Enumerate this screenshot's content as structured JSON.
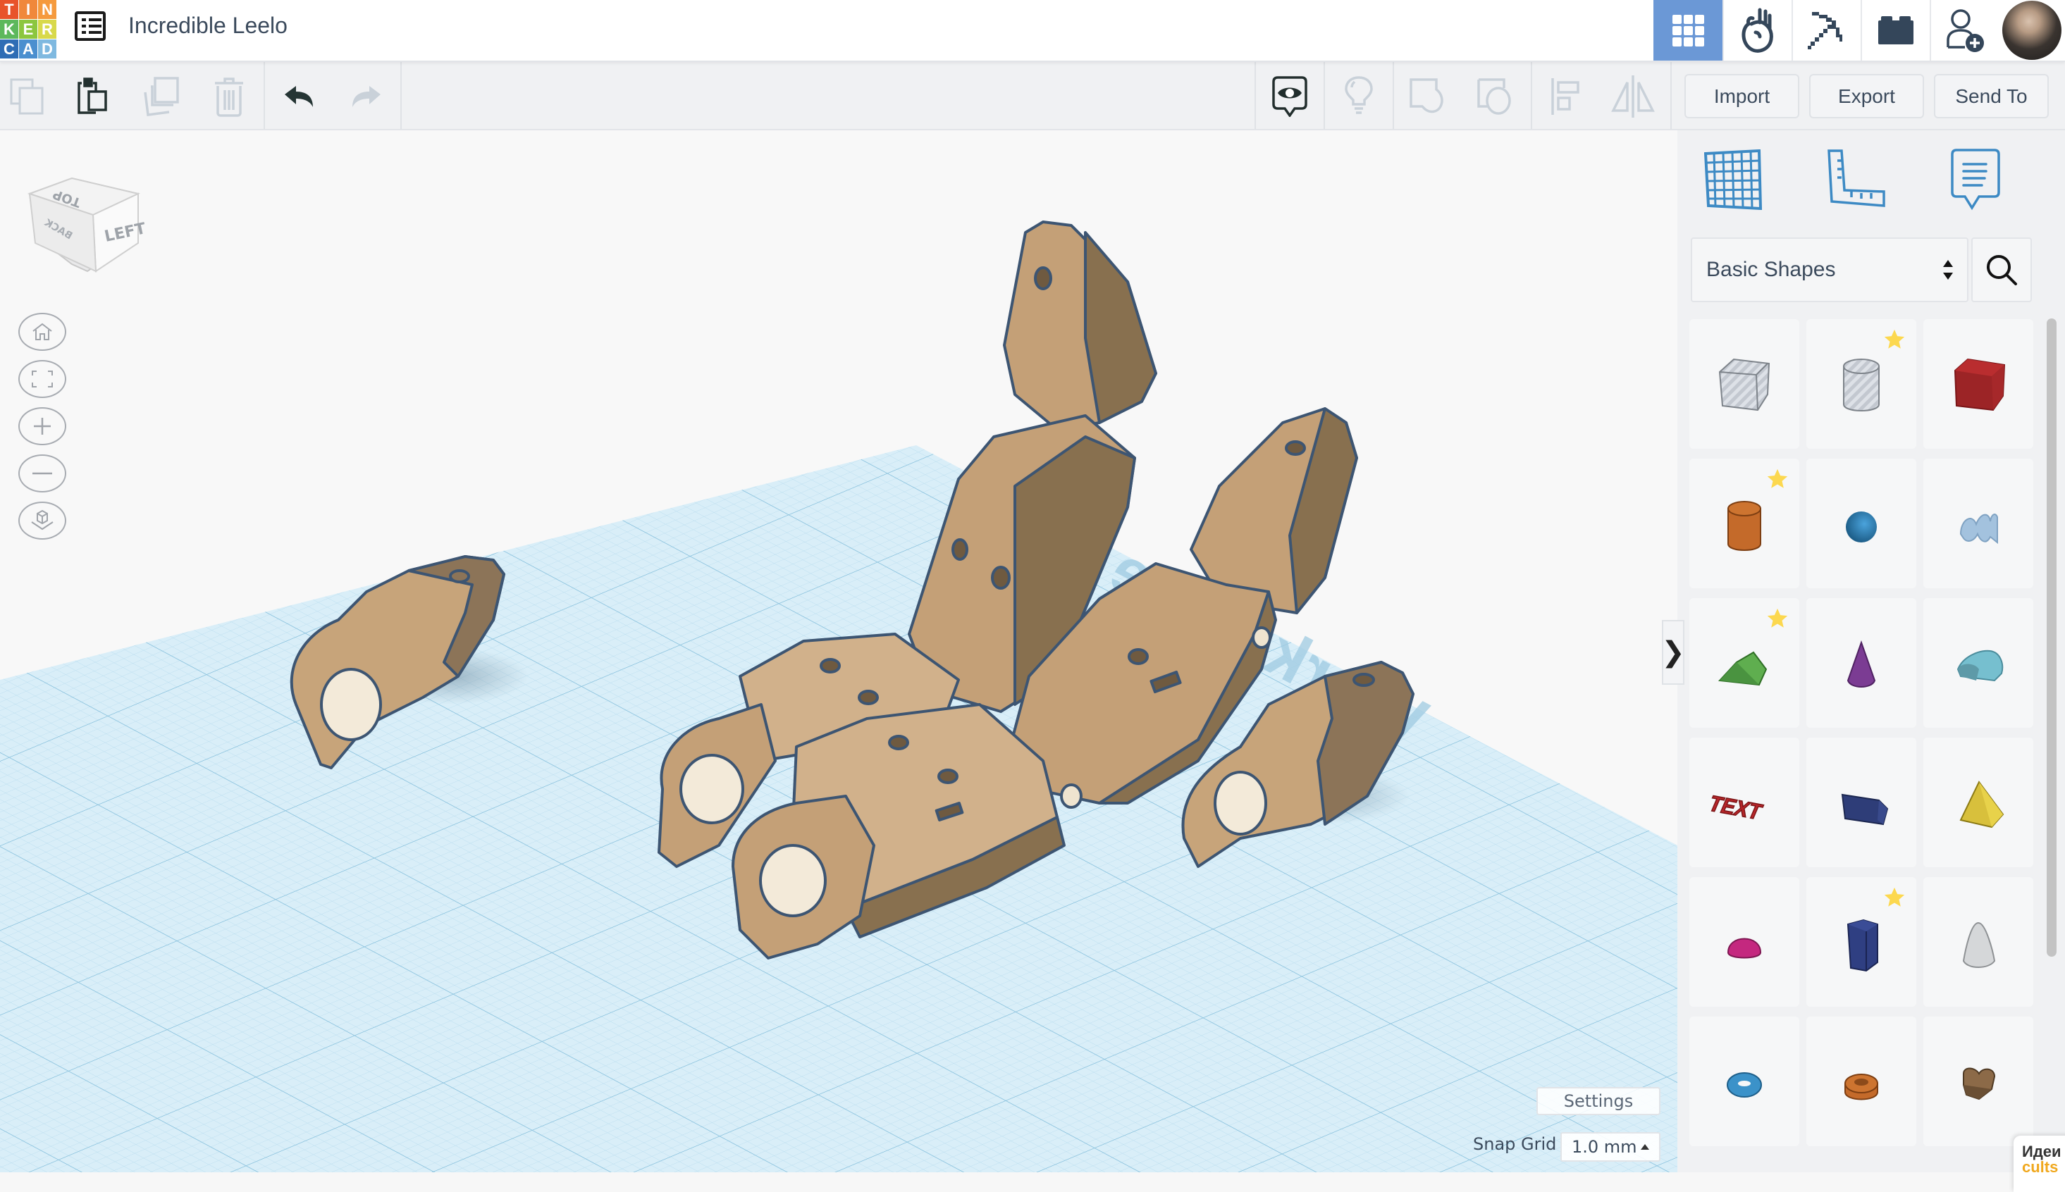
{
  "app": {
    "logo_letters": [
      "T",
      "I",
      "N",
      "K",
      "E",
      "R",
      "C",
      "A",
      "D"
    ],
    "logo_colors": [
      "#e8532b",
      "#f0883b",
      "#f59a3d",
      "#5db85c",
      "#8cc63f",
      "#d8d94b",
      "#2f6db5",
      "#4b8fcf",
      "#7fb9e0"
    ],
    "title": "Incredible Leelo"
  },
  "top_nav": {
    "items": [
      {
        "name": "3d-design",
        "icon": "grid-icon",
        "active": true
      },
      {
        "name": "lessons",
        "icon": "apple-hand-icon",
        "active": false
      },
      {
        "name": "minecraft",
        "icon": "pickaxe-icon",
        "active": false
      },
      {
        "name": "bricks",
        "icon": "brick-icon",
        "active": false
      },
      {
        "name": "invite",
        "icon": "add-user-icon",
        "active": false
      }
    ],
    "avatar": "user-avatar"
  },
  "toolbar": {
    "edit_tools": [
      {
        "name": "copy",
        "icon": "copy-icon",
        "enabled": false
      },
      {
        "name": "paste",
        "icon": "paste-icon",
        "enabled": true
      },
      {
        "name": "duplicate",
        "icon": "duplicate-icon",
        "enabled": false
      },
      {
        "name": "delete",
        "icon": "trash-icon",
        "enabled": false
      },
      {
        "name": "undo",
        "icon": "undo-icon",
        "enabled": true
      },
      {
        "name": "redo",
        "icon": "redo-icon",
        "enabled": false
      }
    ],
    "view_tools": [
      {
        "name": "show-all",
        "icon": "eye-bubble-icon",
        "enabled": true
      },
      {
        "name": "notes",
        "icon": "lightbulb-icon",
        "enabled": false
      },
      {
        "name": "group",
        "icon": "group-icon",
        "enabled": false
      },
      {
        "name": "ungroup",
        "icon": "ungroup-icon",
        "enabled": false
      },
      {
        "name": "align",
        "icon": "align-icon",
        "enabled": false
      },
      {
        "name": "mirror",
        "icon": "mirror-icon",
        "enabled": false
      }
    ],
    "import_label": "Import",
    "export_label": "Export",
    "send_to_label": "Send To"
  },
  "viewcube": {
    "faces": {
      "top": "TOP",
      "left": "LEFT",
      "back": "BACK"
    }
  },
  "view_controls": [
    "home-view",
    "fit-all",
    "zoom-in",
    "zoom-out",
    "perspective-toggle"
  ],
  "workplane": {
    "watermark": "Workplane",
    "grid_color": "#a8d4ea"
  },
  "model": {
    "color": "#c9a880",
    "outline": "#3d5572"
  },
  "bottom_controls": {
    "settings_label": "Settings",
    "snap_grid_label": "Snap Grid",
    "snap_grid_value": "1.0 mm"
  },
  "panel": {
    "tools": [
      "workplane-tool",
      "ruler-tool",
      "notes-tool"
    ],
    "category": "Basic Shapes",
    "shapes": [
      {
        "name": "box-hole",
        "starred": false
      },
      {
        "name": "cylinder-hole",
        "starred": true
      },
      {
        "name": "box",
        "starred": false
      },
      {
        "name": "cylinder",
        "starred": true
      },
      {
        "name": "sphere",
        "starred": false
      },
      {
        "name": "scribble",
        "starred": false
      },
      {
        "name": "roof",
        "starred": true
      },
      {
        "name": "cone",
        "starred": false
      },
      {
        "name": "round-roof",
        "starred": false
      },
      {
        "name": "text",
        "starred": false,
        "label": "TEXT"
      },
      {
        "name": "wedge",
        "starred": false
      },
      {
        "name": "pyramid",
        "starred": false
      },
      {
        "name": "half-sphere",
        "starred": false
      },
      {
        "name": "polygon",
        "starred": true
      },
      {
        "name": "paraboloid",
        "starred": false
      },
      {
        "name": "torus",
        "starred": false
      },
      {
        "name": "tube",
        "starred": false
      },
      {
        "name": "heart",
        "starred": false
      }
    ]
  },
  "toast": {
    "title": "Идеи",
    "link": "cults"
  },
  "collapse_glyph": "❯"
}
